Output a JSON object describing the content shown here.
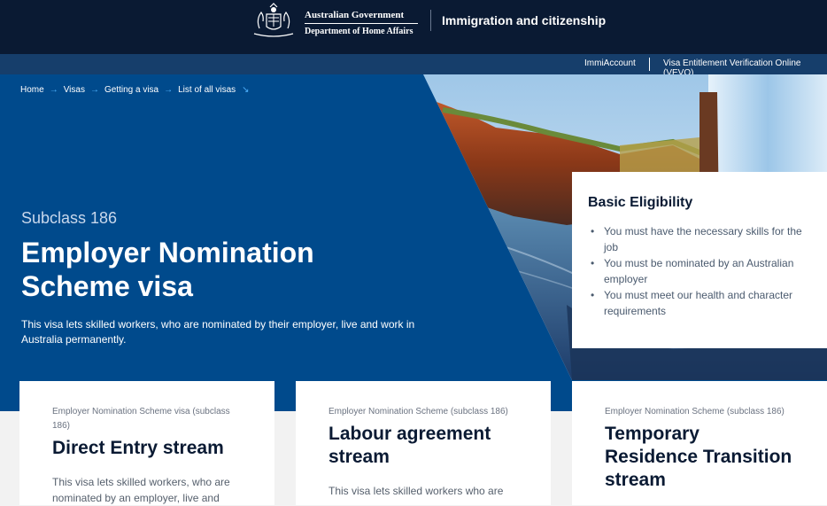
{
  "header": {
    "gov_line1": "Australian Government",
    "gov_line2": "Department of Home Affairs",
    "site_title": "Immigration and citizenship"
  },
  "utility": {
    "immiaccount": "ImmiAccount",
    "vevo": "Visa Entitlement Verification Online (VEVO)"
  },
  "breadcrumb": {
    "home": "Home",
    "visas": "Visas",
    "getting_a_visa": "Getting a visa",
    "list_of_all_visas": "List of all visas",
    "arrow": "→",
    "down_arrow": "↘"
  },
  "hero": {
    "subclass": "Subclass 186",
    "title": "Employer Nomination Scheme visa",
    "description": "This visa lets skilled workers, who are nominated by their employer, live and work in Australia permanently."
  },
  "eligibility": {
    "heading": "Basic Eligibility",
    "bullet": "•",
    "items": [
      "You must have the necessary skills for the job",
      "You must be nominated by an Australian employer",
      "You must meet our health and character requirements"
    ]
  },
  "cards": [
    {
      "kicker": "Employer Nomination Scheme visa (subclass 186)",
      "title": "Direct Entry stream",
      "description": "This visa lets skilled workers, who are nominated by an employer, live and"
    },
    {
      "kicker": "Employer Nomination Scheme (subclass 186)",
      "title": "Labour agreement stream",
      "description": "This visa lets skilled workers who are"
    },
    {
      "kicker": "Employer Nomination Scheme (subclass 186)",
      "title": "Temporary Residence Transition stream",
      "description": ""
    }
  ],
  "colors": {
    "header_bg": "#0a1a33",
    "utility_bg": "#163e6b",
    "hero_bg": "#004a8c",
    "breadcrumb_arrow": "#4fb3ff"
  }
}
